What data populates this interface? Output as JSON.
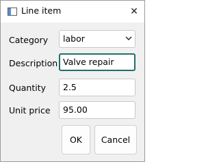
{
  "window": {
    "title": "Line item",
    "close_glyph": "✕"
  },
  "form": {
    "category": {
      "label": "Category",
      "value": "labor"
    },
    "description": {
      "label": "Description",
      "value": "Valve repair"
    },
    "quantity": {
      "label": "Quantity",
      "value": "2.5"
    },
    "unit_price": {
      "label": "Unit price",
      "value": "95.00"
    }
  },
  "buttons": {
    "ok_label": "OK",
    "cancel_label": "Cancel"
  },
  "colors": {
    "focus_border": "#1f6f6a",
    "window_bg": "#f0f0f0"
  },
  "icons": {
    "app": "app-window-icon",
    "close": "close-icon",
    "dropdown": "chevron-down-icon"
  }
}
